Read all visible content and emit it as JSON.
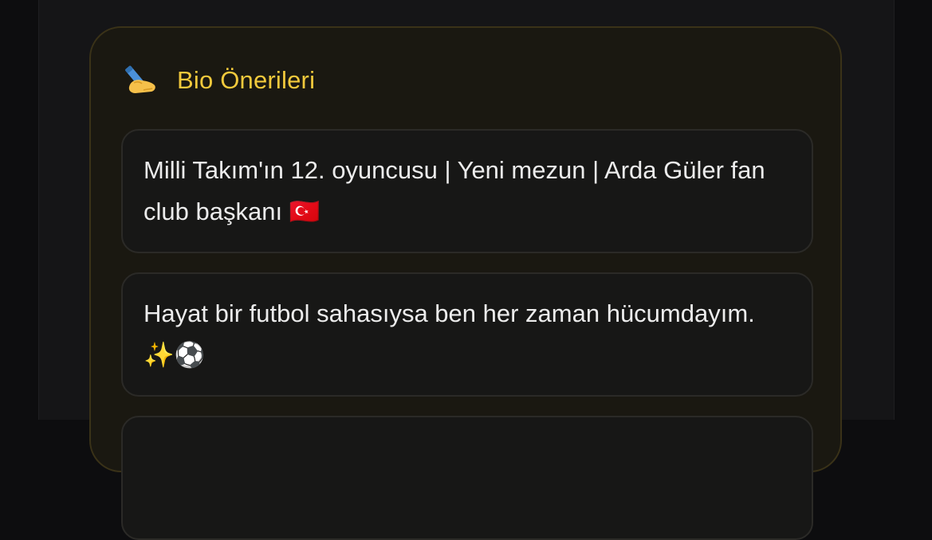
{
  "bio_suggestions": {
    "title": "Bio Önerileri",
    "header_icon": "writing-hand-icon",
    "accent_color": "#f2c93c",
    "items": [
      {
        "text": "Milli Takım'ın 12. oyuncusu | Yeni mezun | Arda Güler fan club başkanı 🇹🇷"
      },
      {
        "text": "Hayat bir futbol sahasıysa ben her zaman hücumdayım. ✨⚽"
      }
    ]
  }
}
